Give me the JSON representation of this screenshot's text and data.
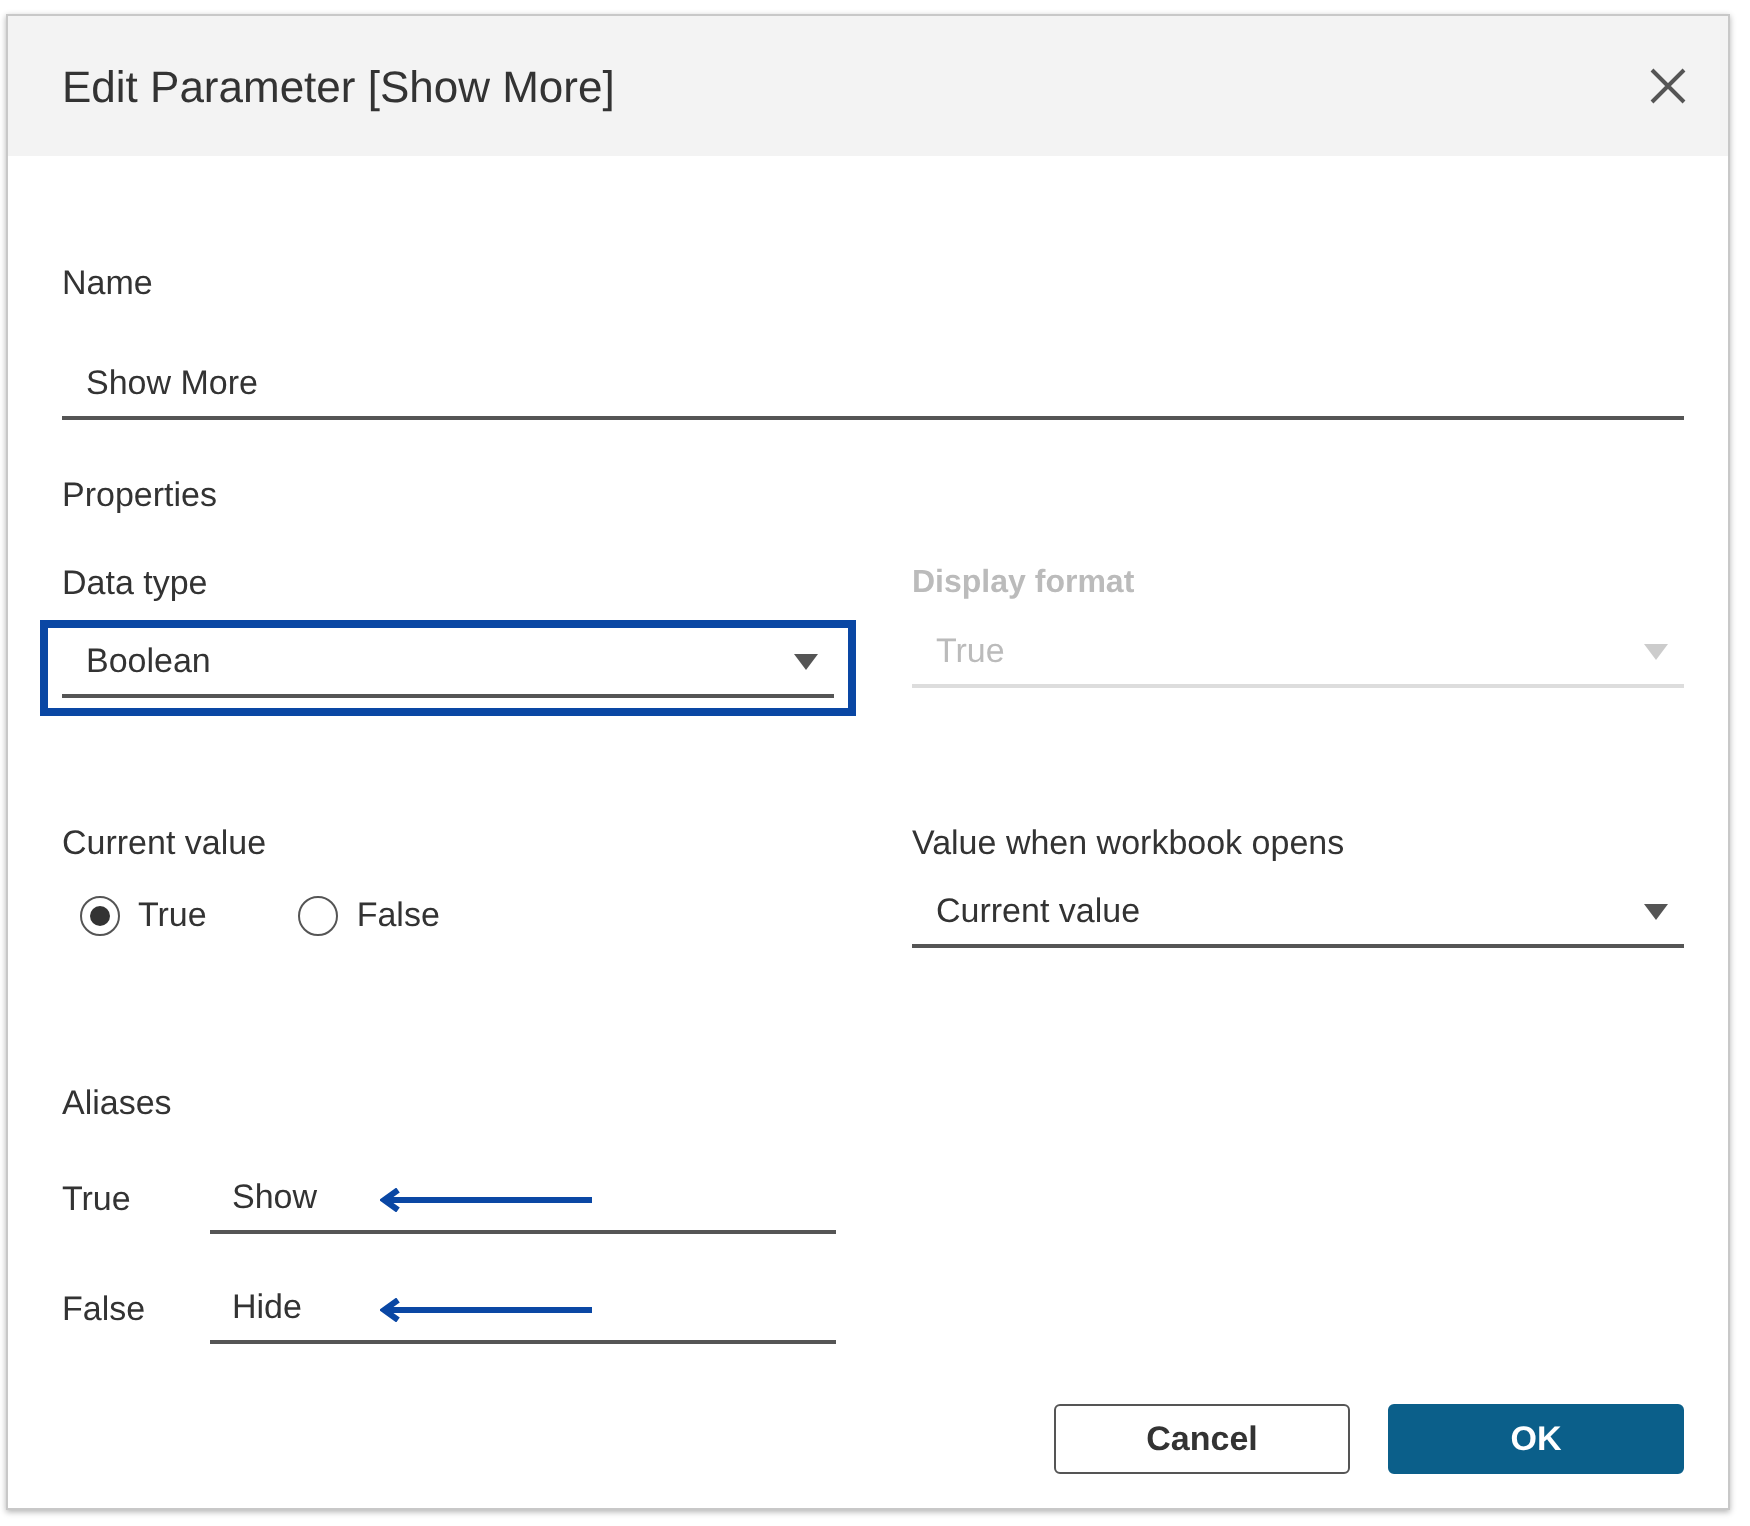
{
  "dialog": {
    "title": "Edit Parameter [Show More]"
  },
  "name": {
    "label": "Name",
    "value": "Show More"
  },
  "properties": {
    "heading": "Properties"
  },
  "data_type": {
    "label": "Data type",
    "value": "Boolean",
    "disabled": false,
    "highlighted": true
  },
  "display_format": {
    "label": "Display format",
    "value": "True",
    "disabled": true
  },
  "current_value": {
    "label": "Current value",
    "options": [
      {
        "label": "True",
        "selected": true
      },
      {
        "label": "False",
        "selected": false
      }
    ]
  },
  "value_when_workbook_opens": {
    "label": "Value when workbook opens",
    "value": "Current value",
    "disabled": false
  },
  "aliases": {
    "heading": "Aliases",
    "rows": [
      {
        "label": "True",
        "value": "Show",
        "arrow": true
      },
      {
        "label": "False",
        "value": "Hide",
        "arrow": true
      }
    ]
  },
  "buttons": [
    {
      "label": "Cancel",
      "kind": "secondary"
    },
    {
      "label": "OK",
      "kind": "primary"
    }
  ]
}
